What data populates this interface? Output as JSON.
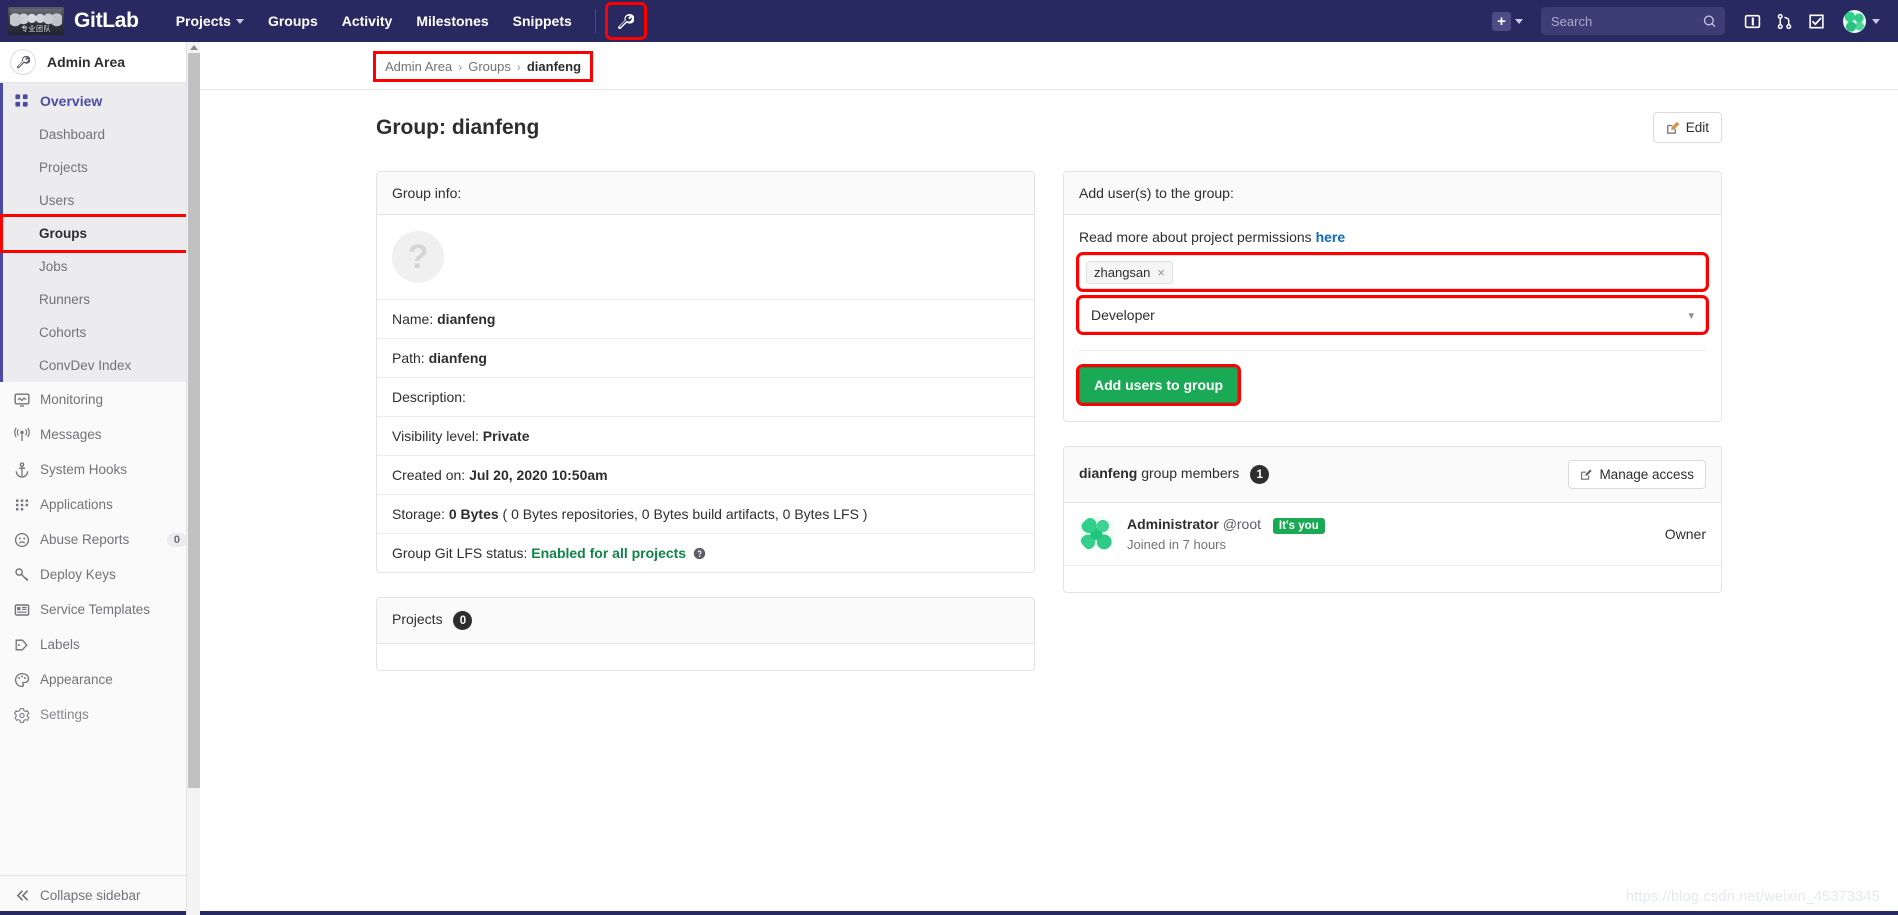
{
  "navbar": {
    "brand": "GitLab",
    "logo_text": "专业团队",
    "links": [
      {
        "label": "Projects",
        "has_caret": true
      },
      {
        "label": "Groups",
        "has_caret": false
      },
      {
        "label": "Activity",
        "has_caret": false
      },
      {
        "label": "Milestones",
        "has_caret": false
      },
      {
        "label": "Snippets",
        "has_caret": false
      }
    ],
    "admin_icon": "wrench-icon",
    "plus_label": "+",
    "search_placeholder": "Search",
    "search_value": "",
    "icons": [
      "issues-board-icon",
      "merge-requests-icon",
      "todos-icon"
    ]
  },
  "sidebar": {
    "header": "Admin Area",
    "header_icon": "wrench-icon",
    "overview": {
      "label": "Overview",
      "icon": "grid-icon"
    },
    "sub_items": [
      {
        "label": "Dashboard",
        "current": false
      },
      {
        "label": "Projects",
        "current": false
      },
      {
        "label": "Users",
        "current": false
      },
      {
        "label": "Groups",
        "current": true
      },
      {
        "label": "Jobs",
        "current": false
      },
      {
        "label": "Runners",
        "current": false
      },
      {
        "label": "Cohorts",
        "current": false
      },
      {
        "label": "ConvDev Index",
        "current": false
      }
    ],
    "items": [
      {
        "label": "Monitoring",
        "icon": "monitor-icon",
        "badge": null
      },
      {
        "label": "Messages",
        "icon": "broadcast-icon",
        "badge": null
      },
      {
        "label": "System Hooks",
        "icon": "hook-icon",
        "badge": null
      },
      {
        "label": "Applications",
        "icon": "apps-icon",
        "badge": null
      },
      {
        "label": "Abuse Reports",
        "icon": "frown-icon",
        "badge": "0"
      },
      {
        "label": "Deploy Keys",
        "icon": "key-icon",
        "badge": null
      },
      {
        "label": "Service Templates",
        "icon": "template-icon",
        "badge": null
      },
      {
        "label": "Labels",
        "icon": "label-icon",
        "badge": null
      },
      {
        "label": "Appearance",
        "icon": "palette-icon",
        "badge": null
      },
      {
        "label": "Settings",
        "icon": "settings-icon",
        "badge": null
      }
    ],
    "collapse": {
      "label": "Collapse sidebar",
      "icon": "double-chevron-left-icon"
    }
  },
  "breadcrumb": {
    "items": [
      "Admin Area",
      "Groups"
    ],
    "current": "dianfeng",
    "separator": "›"
  },
  "page": {
    "title": "Group: dianfeng",
    "edit_button": "Edit",
    "edit_icon": "pencil-square-icon"
  },
  "group_info": {
    "header": "Group info:",
    "avatar_placeholder": "?",
    "rows": [
      {
        "label": "Name:",
        "value": "dianfeng",
        "strong": true
      },
      {
        "label": "Path:",
        "value": "dianfeng",
        "strong": true
      },
      {
        "label": "Description:",
        "value": "",
        "strong": false
      },
      {
        "label": "Visibility level:",
        "value": "Private",
        "strong": true
      },
      {
        "label": "Created on:",
        "value": "Jul 20, 2020 10:50am",
        "strong": true
      },
      {
        "label": "Storage:",
        "value": "0 Bytes",
        "strong": true,
        "suffix": "( 0 Bytes repositories, 0 Bytes build artifacts, 0 Bytes LFS )"
      },
      {
        "label": "Group Git LFS status:",
        "value": "Enabled for all projects",
        "green": true,
        "help_icon": "question-circle-icon"
      }
    ]
  },
  "projects_card": {
    "title": "Projects",
    "count": "0"
  },
  "add_users": {
    "header": "Add user(s) to the group:",
    "helper_prefix": "Read more about project permissions",
    "helper_link": "here",
    "user_token": "zhangsan",
    "token_remove": "×",
    "access_level": "Developer",
    "submit_label": "Add users to group"
  },
  "members": {
    "title_group": "dianfeng",
    "title_rest": "group members",
    "count": "1",
    "manage_button": "Manage access",
    "manage_icon": "pencil-square-icon",
    "rows": [
      {
        "name": "Administrator",
        "handle": "@root",
        "badge": "It's you",
        "joined": "Joined in 7 hours",
        "role": "Owner"
      }
    ]
  },
  "watermark": "https://blog.csdn.net/weixin_45373345",
  "colors": {
    "navbar": "#292961",
    "accent_purple": "#4b4ba3",
    "green": "#1aaa55",
    "link_blue": "#1068bf",
    "highlight_red": "#fe0000",
    "lfs_green": "#108548"
  }
}
